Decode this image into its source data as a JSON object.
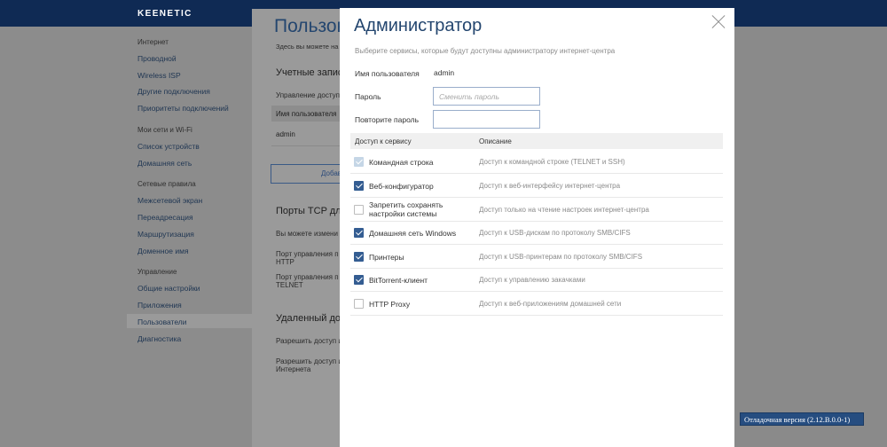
{
  "app": {
    "logo": "KEENETIC"
  },
  "sidebar": {
    "groups": [
      {
        "label": "Интернет",
        "items": [
          "Проводной",
          "Wireless ISP",
          "Другие подключения",
          "Приоритеты подключений"
        ]
      },
      {
        "label": "Мои сети и Wi-Fi",
        "items": [
          "Список устройств",
          "Домашняя сеть"
        ]
      },
      {
        "label": "Сетевые правила",
        "items": [
          "Межсетевой экран",
          "Переадресация",
          "Маршрутизация",
          "Доменное имя"
        ]
      },
      {
        "label": "Управление",
        "items": [
          "Общие настройки",
          "Приложения",
          "Пользователи",
          "Диагностика"
        ]
      }
    ],
    "active_item": "Пользователи"
  },
  "page": {
    "title": "Пользова",
    "subtitle": "Здесь вы можете на",
    "accounts_section": "Учетные записи",
    "accounts_desc": "Управление доступ",
    "table_header": "Имя пользователя",
    "table_row": "admin",
    "add_button": "Добав",
    "ports_section": "Порты TCP для",
    "ports_desc": "Вы можете измени",
    "port_http_label": "Порт управления п",
    "port_http_label2": "HTTP",
    "port_telnet_label": "Порт управления п",
    "port_telnet_label2": "TELNET",
    "remote_section": "Удаленный дос",
    "remote_desc": "Разрешить доступ и",
    "remote_allow": "Разрешить доступ и",
    "remote_allow2": "Интернета"
  },
  "modal": {
    "title": "Администратор",
    "subtitle": "Выберите сервисы, которые будут доступны администратору интернет-центра",
    "username_label": "Имя пользователя",
    "username_value": "admin",
    "password_label": "Пароль",
    "password_placeholder": "Сменить пароль",
    "password_repeat_label": "Повторите пароль",
    "password_repeat_value": "",
    "columns": {
      "access": "Доступ к сервису",
      "description": "Описание"
    },
    "services": [
      {
        "name": "Командная строка",
        "description": "Доступ к командной строке (TELNET и SSH)",
        "state": "checked-disabled"
      },
      {
        "name": "Веб-конфигуратор",
        "description": "Доступ к веб-интерфейсу интернет-центра",
        "state": "checked"
      },
      {
        "name": "Запретить сохранять настройки системы",
        "description": "Доступ только на чтение настроек интернет-центра",
        "state": "unchecked"
      },
      {
        "name": "Домашняя сеть Windows",
        "description": "Доступ к USB-дискам по протоколу SMB/CIFS",
        "state": "checked"
      },
      {
        "name": "Принтеры",
        "description": "Доступ к USB-принтерам по протоколу SMB/CIFS",
        "state": "checked"
      },
      {
        "name": "BitTorrent-клиент",
        "description": "Доступ к управлению закачками",
        "state": "checked"
      },
      {
        "name": "HTTP Proxy",
        "description": "Доступ к веб-приложениям домашней сети",
        "state": "unchecked"
      }
    ]
  },
  "footer": {
    "debug_version": "Отладочная версия (2.12.B.0.0-1)"
  },
  "colors": {
    "topbar": "#0f2a54",
    "accent": "#345d92",
    "title": "#24466f",
    "overlay": "#8a8a8a"
  }
}
